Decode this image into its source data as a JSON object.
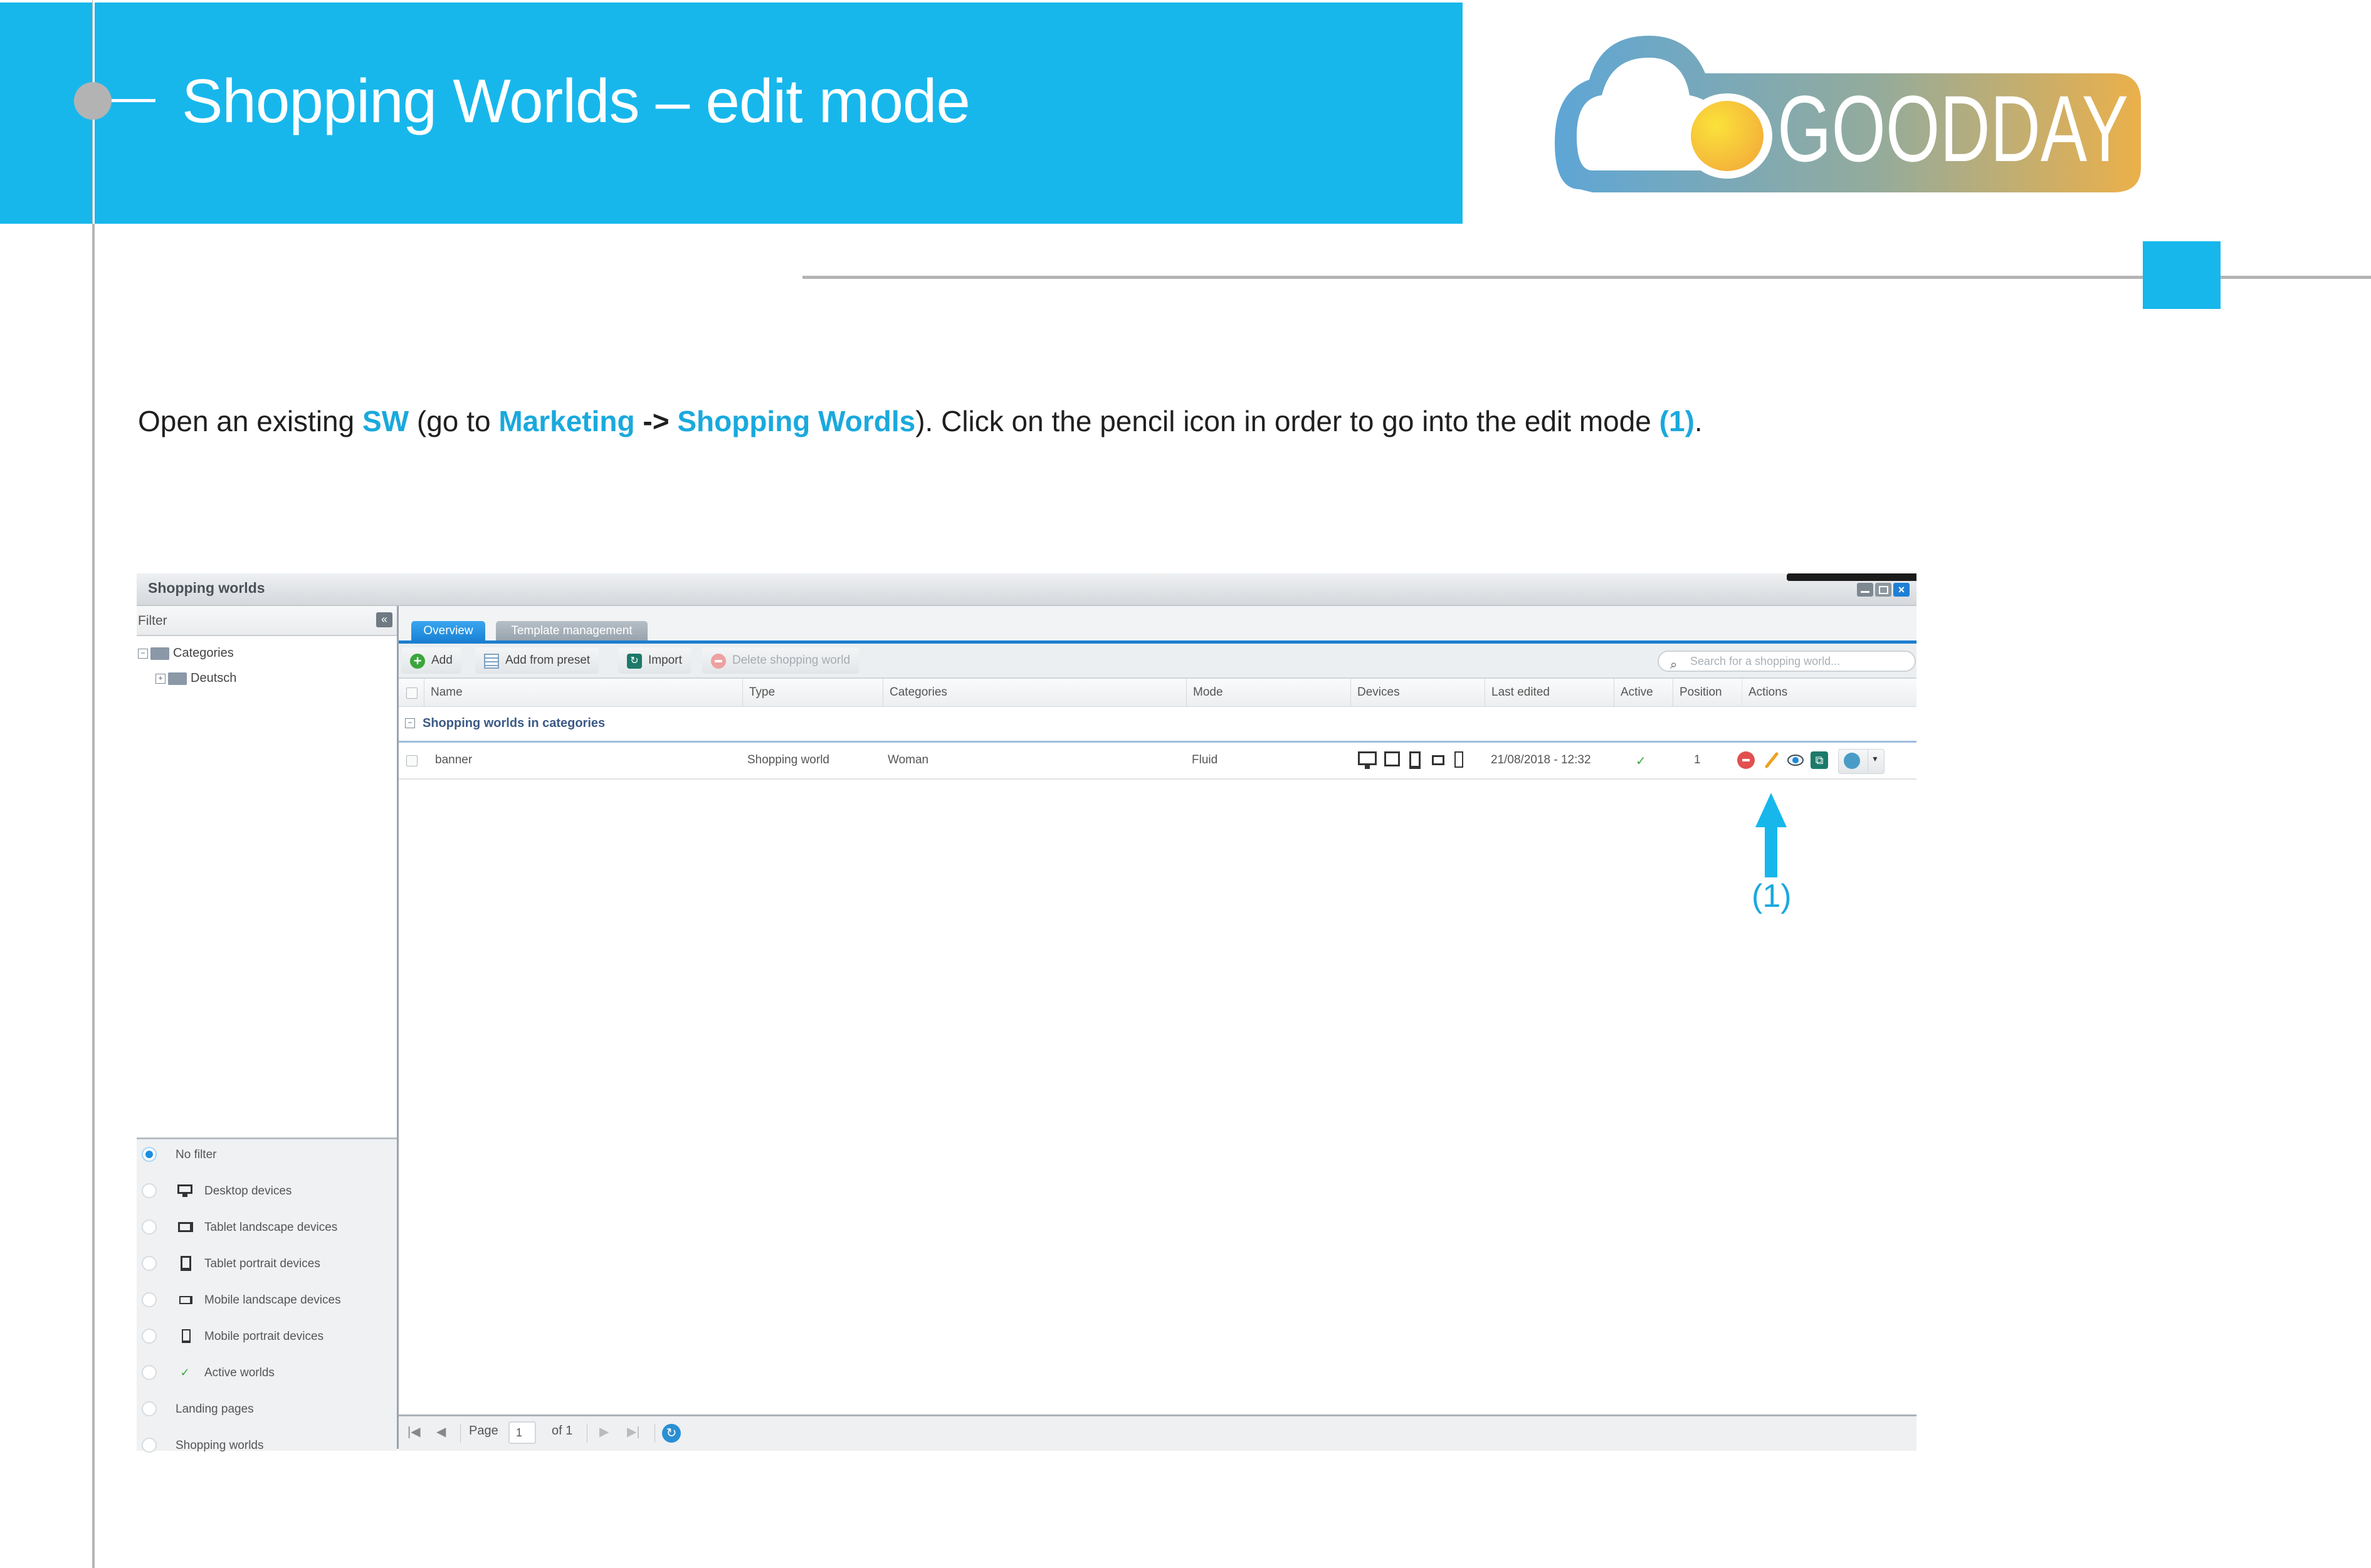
{
  "slide": {
    "title": "Shopping Worlds – edit mode",
    "logo_text": "GOODDAY",
    "accent_color": "#17b7ec",
    "instruction": {
      "p1": "Open an existing ",
      "sw": "SW",
      "p2": " (go to ",
      "marketing": "Marketing",
      "arrow": " -> ",
      "shopping_words": "Shopping Wordls",
      "p3": "). Click on the pencil icon in order to go into the edit mode ",
      "ref": "(1)",
      "p4": "."
    },
    "callout_label": "(1)"
  },
  "window": {
    "title": "Shopping worlds",
    "controls": [
      "minimize-icon",
      "maximize-icon",
      "close-icon"
    ],
    "sidebar": {
      "filter_label": "Filter",
      "collapse_icon": "«",
      "tree": [
        {
          "label": "Categories",
          "expander": "−"
        },
        {
          "label": "Deutsch",
          "expander": "+"
        }
      ],
      "filters": [
        {
          "label": "No filter",
          "icon": "",
          "selected": true
        },
        {
          "label": "Desktop devices",
          "icon": "desktop-icon",
          "selected": false
        },
        {
          "label": "Tablet landscape devices",
          "icon": "tablet-landscape-icon",
          "selected": false
        },
        {
          "label": "Tablet portrait devices",
          "icon": "tablet-portrait-icon",
          "selected": false
        },
        {
          "label": "Mobile landscape devices",
          "icon": "mobile-landscape-icon",
          "selected": false
        },
        {
          "label": "Mobile portrait devices",
          "icon": "mobile-portrait-icon",
          "selected": false
        },
        {
          "label": "Active worlds",
          "icon": "check-icon",
          "selected": false
        },
        {
          "label": "Landing pages",
          "icon": "",
          "selected": false
        },
        {
          "label": "Shopping worlds",
          "icon": "",
          "selected": false
        }
      ]
    },
    "tabs": [
      {
        "label": "Overview",
        "active": true
      },
      {
        "label": "Template management",
        "active": false
      }
    ],
    "toolbar": {
      "add": "Add",
      "add_from_preset": "Add from preset",
      "import": "Import",
      "delete": "Delete shopping world",
      "search_placeholder": "Search for a shopping world..."
    },
    "grid": {
      "columns": [
        "Name",
        "Type",
        "Categories",
        "Mode",
        "Devices",
        "Last edited",
        "Active",
        "Position",
        "Actions"
      ],
      "group_label": "Shopping worlds in categories",
      "rows": [
        {
          "name": "banner",
          "type": "Shopping world",
          "categories": "Woman",
          "mode": "Fluid",
          "devices": [
            "desktop",
            "tablet-landscape",
            "tablet-portrait",
            "mobile-landscape",
            "mobile-portrait"
          ],
          "last_edited": "21/08/2018 - 12:32",
          "active": "✓",
          "position": "1",
          "actions": [
            "delete-icon",
            "pencil-icon",
            "preview-icon",
            "duplicate-icon",
            "copy-icon"
          ]
        }
      ]
    },
    "pager": {
      "page_label": "Page",
      "page_value": "1",
      "of_label": "of 1"
    }
  }
}
